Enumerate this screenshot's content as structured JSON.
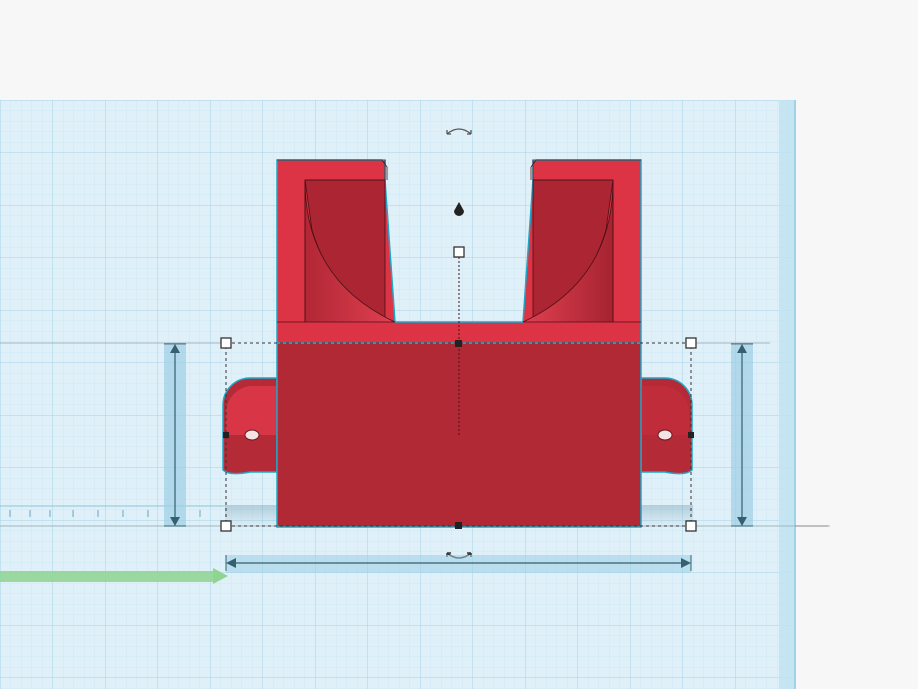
{
  "app": {
    "view": "3d-workplane-front-view"
  },
  "colors": {
    "background": "#f7f7f7",
    "workplane_fill": "#dff0f8",
    "workplane_border": "#9fd3ea",
    "grid_minor": "#c9e5f2",
    "grid_major": "#9fcfe3",
    "shape_light": "#dc3444",
    "shape_mid": "#c02c3a",
    "shape_dark": "#ad2633",
    "shape_outline": "#1ea7c8",
    "handle_stroke": "#333333",
    "dimension_arrow": "#35606f",
    "dimension_band": "#9dcfe5",
    "axis_green": "#8fd491"
  },
  "scene": {
    "selected_object": "red-u-bracket-with-side-tabs",
    "handles": [
      "rotate-top-handle",
      "rotate-bottom-handle",
      "lift-cone-handle",
      "height-handle",
      "corner-resize-handles",
      "edge-midpoint-handles"
    ],
    "dimension_guides": [
      "left-height-dimension",
      "right-height-dimension",
      "bottom-width-dimension"
    ]
  }
}
